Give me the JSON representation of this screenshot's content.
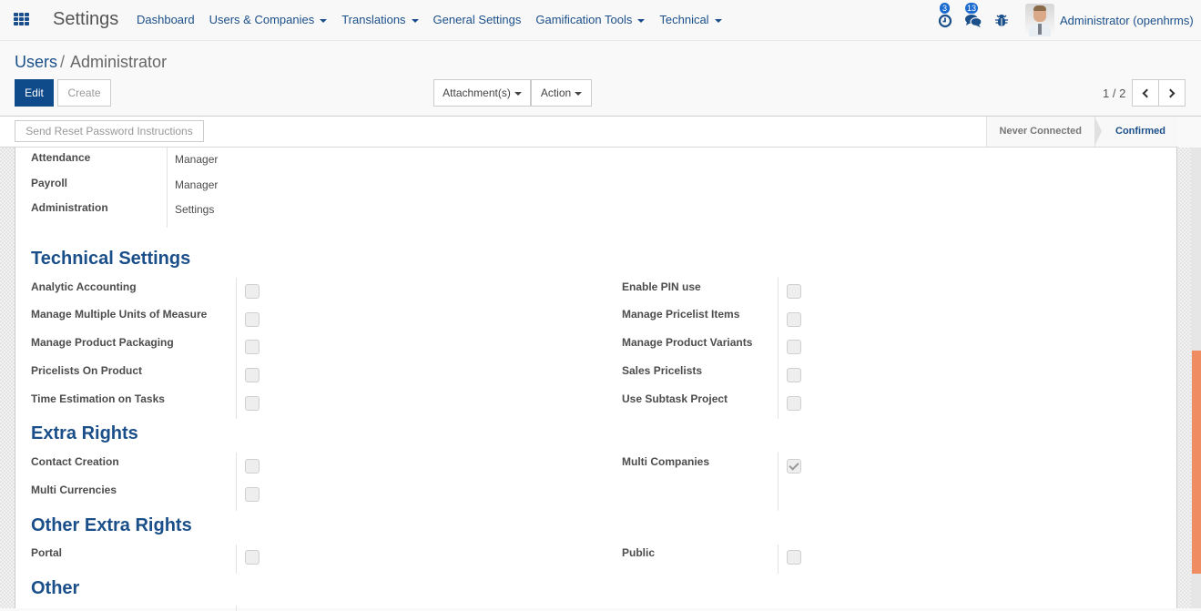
{
  "navbar": {
    "app_title": "Settings",
    "menu": [
      {
        "label": "Dashboard",
        "dropdown": false
      },
      {
        "label": "Users & Companies",
        "dropdown": true
      },
      {
        "label": "Translations",
        "dropdown": true
      },
      {
        "label": "General Settings",
        "dropdown": false
      },
      {
        "label": "Gamification Tools",
        "dropdown": true
      },
      {
        "label": "Technical",
        "dropdown": true
      }
    ],
    "activities_count": "3",
    "messages_count": "13",
    "user_name": "Administrator (openhrms)",
    "icons": [
      "apps-grid-icon",
      "clock-icon",
      "chat-icon",
      "bug-icon",
      "user-avatar"
    ]
  },
  "breadcrumb": {
    "parent": "Users",
    "separator": "/",
    "current": "Administrator"
  },
  "toolbar": {
    "edit_label": "Edit",
    "create_label": "Create",
    "attachments_label": "Attachment(s)",
    "action_label": "Action",
    "pager": "1 / 2"
  },
  "statusbar": {
    "reset_password_label": "Send Reset Password Instructions",
    "stages": [
      {
        "label": "Never Connected",
        "active": false
      },
      {
        "label": "Confirmed",
        "active": true
      }
    ]
  },
  "access_rights": [
    {
      "label": "Attendance",
      "value": "Manager"
    },
    {
      "label": "Payroll",
      "value": "Manager"
    },
    {
      "label": "Administration",
      "value": "Settings"
    }
  ],
  "sections": {
    "technical_settings": {
      "title": "Technical Settings",
      "left": [
        {
          "label": "Analytic Accounting",
          "checked": false
        },
        {
          "label": "Manage Multiple Units of Measure",
          "checked": false
        },
        {
          "label": "Manage Product Packaging",
          "checked": false
        },
        {
          "label": "Pricelists On Product",
          "checked": false
        },
        {
          "label": "Time Estimation on Tasks",
          "checked": false
        }
      ],
      "right": [
        {
          "label": "Enable PIN use",
          "checked": false
        },
        {
          "label": "Manage Pricelist Items",
          "checked": false
        },
        {
          "label": "Manage Product Variants",
          "checked": false
        },
        {
          "label": "Sales Pricelists",
          "checked": false
        },
        {
          "label": "Use Subtask Project",
          "checked": false
        }
      ]
    },
    "extra_rights": {
      "title": "Extra Rights",
      "left": [
        {
          "label": "Contact Creation",
          "checked": false
        },
        {
          "label": "Multi Currencies",
          "checked": false
        }
      ],
      "right": [
        {
          "label": "Multi Companies",
          "checked": true
        }
      ]
    },
    "other_extra_rights": {
      "title": "Other Extra Rights",
      "left": [
        {
          "label": "Portal",
          "checked": false
        }
      ],
      "right": [
        {
          "label": "Public",
          "checked": false
        }
      ]
    },
    "other": {
      "title": "Other"
    }
  },
  "colors": {
    "brand": "#1b4f8a",
    "primary_button": "#0f4a8a",
    "scrollbar_thumb": "#ef8c62",
    "badge": "#1b6bd1"
  }
}
